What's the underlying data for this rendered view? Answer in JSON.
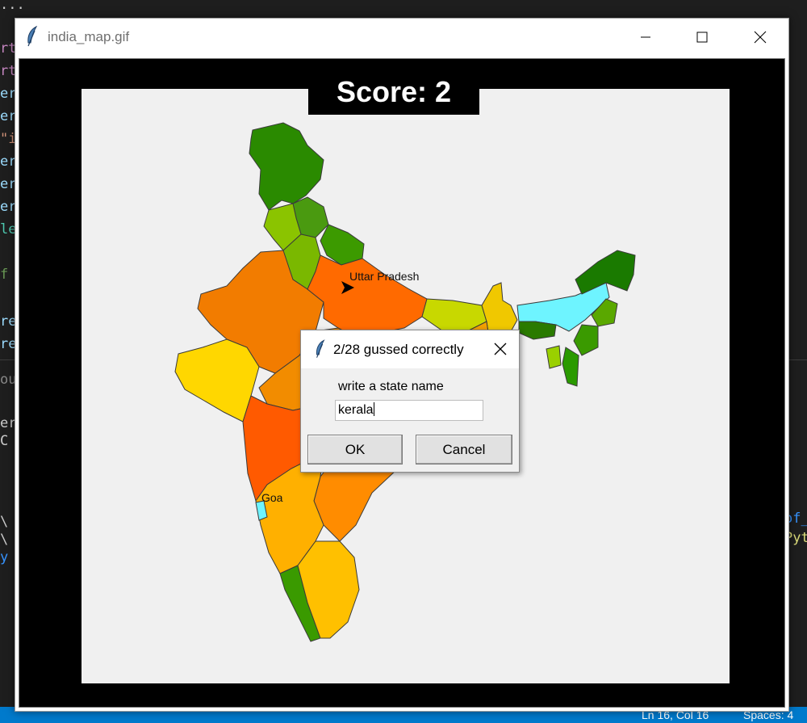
{
  "window": {
    "title": "india_map.gif"
  },
  "game": {
    "score_text": "Score: 2",
    "labels": {
      "uttar_pradesh": "Uttar Pradesh",
      "goa": "Goa"
    }
  },
  "dialog": {
    "title": "2/28 gussed correctly",
    "prompt": "write a state name",
    "input_value": "kerala",
    "ok_label": "OK",
    "cancel_label": "Cancel"
  },
  "statusbar": {
    "position": "Ln 16, Col 16",
    "spaces": "Spaces: 4"
  },
  "background_editor": {
    "gutter_fragments": [
      "rt",
      "rt",
      "er",
      "er",
      "\"i",
      "er",
      "er",
      "er",
      "le",
      "f",
      "re",
      "re",
      "ou",
      "er",
      "C",
      "",
      "\\",
      "\\",
      "y"
    ],
    "right_fragments": [
      "of_",
      "Pyt"
    ]
  },
  "colors": {
    "statusbar": "#007acc",
    "editor_bg": "#1e1e1e",
    "canvas": "#000000"
  }
}
